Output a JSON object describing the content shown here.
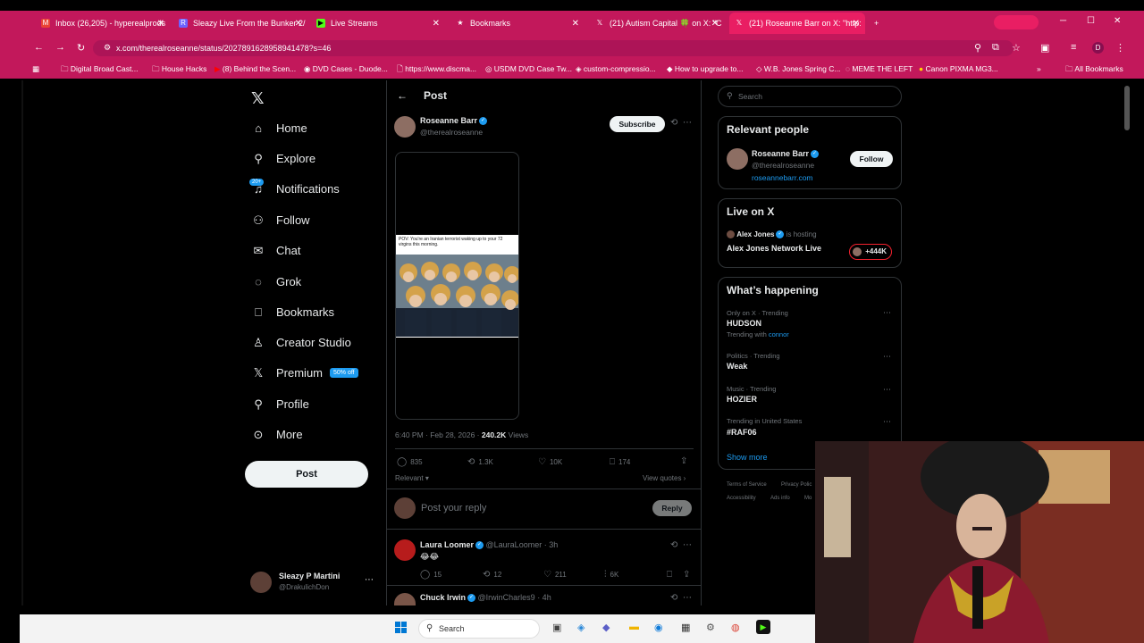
{
  "browser": {
    "tabs": [
      {
        "label": "Inbox (26,205) - hyperealprods",
        "color": "#ea4335"
      },
      {
        "label": "Sleazy Live From the Bunker 2/",
        "color": "#6c63ff"
      },
      {
        "label": "Live Streams",
        "color": "#53fc18"
      },
      {
        "label": "Bookmarks",
        "color": "#ffffff"
      },
      {
        "label": "(21) Autism Capital 🍀 on X: \"C",
        "color": "#000000"
      },
      {
        "label": "(21) Roseanne Barr on X: \"http:",
        "color": "#000000"
      }
    ],
    "url": "x.com/therealroseanne/status/2027891628958941478?s=46",
    "bookmarks": [
      "Digital Broad Cast...",
      "House Hacks",
      "(8) Behind the Scen...",
      "DVD Cases - Duode...",
      "https://www.discma...",
      "USDM DVD Case Tw...",
      "custom-compressio...",
      "How to upgrade to...",
      "W.B. Jones Spring C...",
      "MEME THE LEFT",
      "Canon PIXMA MG3...",
      "All Bookmarks"
    ],
    "profile_initial": "D"
  },
  "nav": {
    "items": [
      {
        "label": "Home",
        "icon": "home-icon",
        "glyph": "⌂"
      },
      {
        "label": "Explore",
        "icon": "search-icon",
        "glyph": "⚲"
      },
      {
        "label": "Notifications",
        "icon": "bell-icon",
        "glyph": "🔔",
        "badge": "20+"
      },
      {
        "label": "Follow",
        "icon": "follow-icon",
        "glyph": "👤"
      },
      {
        "label": "Chat",
        "icon": "mail-icon",
        "glyph": "✉"
      },
      {
        "label": "Grok",
        "icon": "grok-icon",
        "glyph": "◌"
      },
      {
        "label": "Bookmarks",
        "icon": "bookmark-icon",
        "glyph": "🔖"
      },
      {
        "label": "Creator Studio",
        "icon": "creator-icon",
        "glyph": "♙"
      },
      {
        "label": "Premium",
        "icon": "x-icon",
        "glyph": "𝕏",
        "badge": "50% off"
      },
      {
        "label": "Profile",
        "icon": "profile-icon",
        "glyph": "👤"
      },
      {
        "label": "More",
        "icon": "more-icon",
        "glyph": "⋯"
      }
    ],
    "post_button": "Post",
    "account": {
      "name": "Sleazy P Martini",
      "handle": "@DrakulichDon"
    }
  },
  "post": {
    "header_title": "Post",
    "author_name": "Roseanne Barr",
    "author_handle": "@therealroseanne",
    "subscribe_label": "Subscribe",
    "image_caption": "POV: You're an Iranian terrorist waking up to your 72 virgins this morning.",
    "timestamp": "6:40 PM · Feb 28, 2026 ·",
    "views_count": "240.2K",
    "views_label": "Views",
    "stats": {
      "replies": "835",
      "reposts": "1.3K",
      "likes": "10K",
      "bookmarks": "174"
    },
    "sort_label": "Relevant",
    "view_quotes": "View quotes",
    "reply_placeholder": "Post your reply",
    "reply_button": "Reply"
  },
  "replies": [
    {
      "name": "Laura Loomer",
      "handle": "@LauraLoomer · 3h",
      "text": "😂😂",
      "replies": "15",
      "reposts": "12",
      "likes": "211",
      "views": "6K"
    },
    {
      "name": "Chuck Irwin",
      "handle": "@IrwinCharles9 · 4h"
    }
  ],
  "sidebar": {
    "search_placeholder": "Search",
    "relevant_title": "Relevant people",
    "relevant_name": "Roseanne Barr",
    "relevant_handle": "@therealroseanne",
    "relevant_link": "roseannebarr.com",
    "follow_label": "Follow",
    "live_title": "Live on X",
    "live_host": "Alex Jones",
    "live_hosting": "is hosting",
    "live_show": "Alex Jones Network Live",
    "live_count": "+444K",
    "happening_title": "What’s happening",
    "trends": [
      {
        "context": "Only on X · Trending",
        "topic": "HUDSON",
        "extra_prefix": "Trending with",
        "extra_link": "connor"
      },
      {
        "context": "Politics · Trending",
        "topic": "Weak"
      },
      {
        "context": "Music · Trending",
        "topic": "HOZIER"
      },
      {
        "context": "Trending in United States",
        "topic": "#RAF06"
      }
    ],
    "show_more": "Show more",
    "footer_links": [
      "Terms of Service",
      "Privacy Polic",
      "Accessibility",
      "Ads info",
      "Mo"
    ]
  },
  "taskbar": {
    "search_placeholder": "Search"
  },
  "colors": {
    "accent": "#1d9bf0",
    "chrome": "#c2185b",
    "live": "#f4212e"
  }
}
